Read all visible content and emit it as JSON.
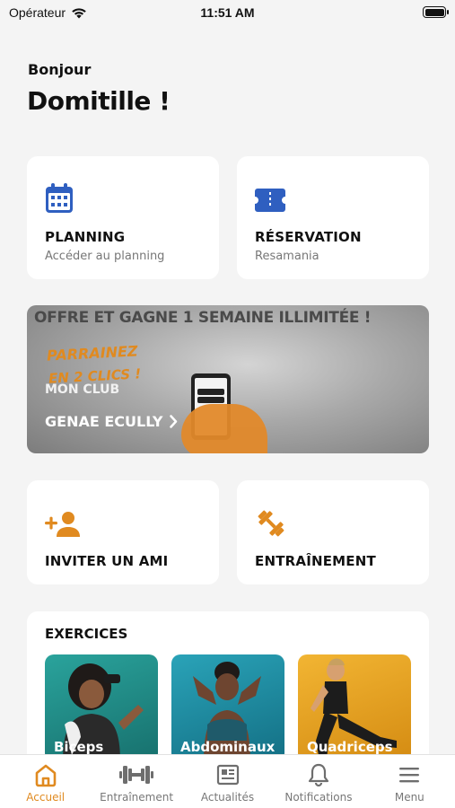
{
  "status_bar": {
    "carrier": "Opérateur",
    "time": "11:51 AM"
  },
  "greeting": "Bonjour",
  "username": "Domitille !",
  "quick_cards": {
    "planning": {
      "title": "PLANNING",
      "subtitle": "Accéder au planning"
    },
    "reservation": {
      "title": "RÉSERVATION",
      "subtitle": "Resamania"
    },
    "invite": {
      "title": "INVITER UN AMI"
    },
    "training": {
      "title": "ENTRAÎNEMENT"
    }
  },
  "banner": {
    "headline": "OFFRE ET GAGNE 1 SEMAINE ILLIMITÉE !",
    "promo_line1": "PARRAINEZ",
    "promo_line2": "EN 2 CLICS !",
    "club_label": "MON CLUB",
    "club_name": "GENAE ECULLY"
  },
  "exercises": {
    "title": "EXERCICES",
    "items": [
      {
        "label": "Biceps",
        "color": "#1f8f8a"
      },
      {
        "label": "Abdominaux",
        "color": "#1a8fa6"
      },
      {
        "label": "Quadriceps",
        "color": "#e7a520"
      }
    ]
  },
  "tab_bar": {
    "items": [
      {
        "label": "Accueil",
        "icon": "home-icon",
        "active": true
      },
      {
        "label": "Entraînement",
        "icon": "dumbbell-icon",
        "active": false
      },
      {
        "label": "Actualités",
        "icon": "newspaper-icon",
        "active": false
      },
      {
        "label": "Notifications",
        "icon": "bell-icon",
        "active": false
      },
      {
        "label": "Menu",
        "icon": "hamburger-menu-icon",
        "active": false
      }
    ]
  },
  "colors": {
    "accent": "#e08a20",
    "icon_blue": "#2f5fc0",
    "text": "#111111",
    "muted": "#777777"
  }
}
